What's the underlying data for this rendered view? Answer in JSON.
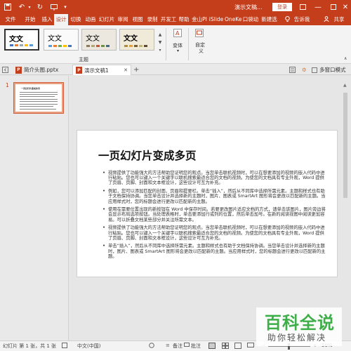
{
  "titlebar": {
    "title": "演示文稿...",
    "login": "登录",
    "tell_me": "告诉我",
    "share": "共享"
  },
  "tabs": [
    "文件",
    "开始",
    "插入",
    "设计",
    "切换",
    "动画",
    "幻灯片",
    "审阅",
    "视图",
    "录制",
    "开发工",
    "帮助",
    "金山PI",
    "iSlide",
    "OneKe",
    "口袋动",
    "新建选"
  ],
  "active_tab": "设计",
  "ribbon": {
    "themes_group": "主题",
    "theme_label": "文文",
    "variant": "变体",
    "customize_line1": "自定",
    "customize_line2": "义"
  },
  "doc_tabs": [
    "简介头图.pptx",
    "演示文稿1"
  ],
  "multi_window": "多窗口模式",
  "slide_number": "1",
  "slide": {
    "title": "一页幻灯片变成多页",
    "bullets": [
      "视频提供了功能强大的方法帮助您证明您的观点。当您单击联机视频时，可以在想要添加的视频的嵌入代码中进行粘贴。您也可以键入一个关键字以联机搜索最适合您的文档的视频。为使您的文档具有专业外观，Word 提供了页眉、页脚、封面和文本框设计，这些设计可互为补充。",
      "例如，您可以添加匹配的封面、页眉和提要栏。单击“插入”，然后从不同库中选择所需元素。主题和样式也有助于文档保持协调。当您单击设计并选择新的主题时，图片、图表或 SmartArt 图形将会更改以匹配新的主题。当应用样式时，您的标题会进行更改以匹配新的主题。",
      "使用在需要位置出现的新按钮在 Word 中保存时间。若要更改图片适应文档的方式，请单击该图片，图片旁边将会显示布局选项按钮。当处理表格时，单击要添加行或列的位置，然后单击加号。在新的阅读视图中阅读更加容易。可以折叠文档某些部分并关注所需文本。",
      "视频提供了功能强大的方法帮助您证明您的观点。当您单击联机视频时，可以在想要添加的视频的嵌入代码中进行粘贴。您也可以键入一个关键字以联机搜索最适合您的文档的视频。为使您的文档具有专业外观，Word 提供了页眉、页脚、封面和文本框设计，这些设计可互为补充。",
      "单击“插入”，然后从不同库中选择所需元素。主题和样式也有助于文档保持协调。当您单击设计并选择新的主题时，图片、图表或 SmartArt 图形将会更改以匹配新的主题。当应用样式时，您的标题会进行更改以匹配新的主题。"
    ]
  },
  "thumb_title": "一页幻灯片变成多页",
  "status": {
    "slide_info": "幻灯片 第 1 张，共 1 张",
    "language": "中文(中国)",
    "notes": "备注",
    "comments": "批注",
    "zoom": "50%"
  },
  "watermark": {
    "main": "百科全说",
    "sub": "助你轻松解决"
  },
  "colors": {
    "accent": "#c43e1c",
    "watermark_green": "#3eae48"
  }
}
